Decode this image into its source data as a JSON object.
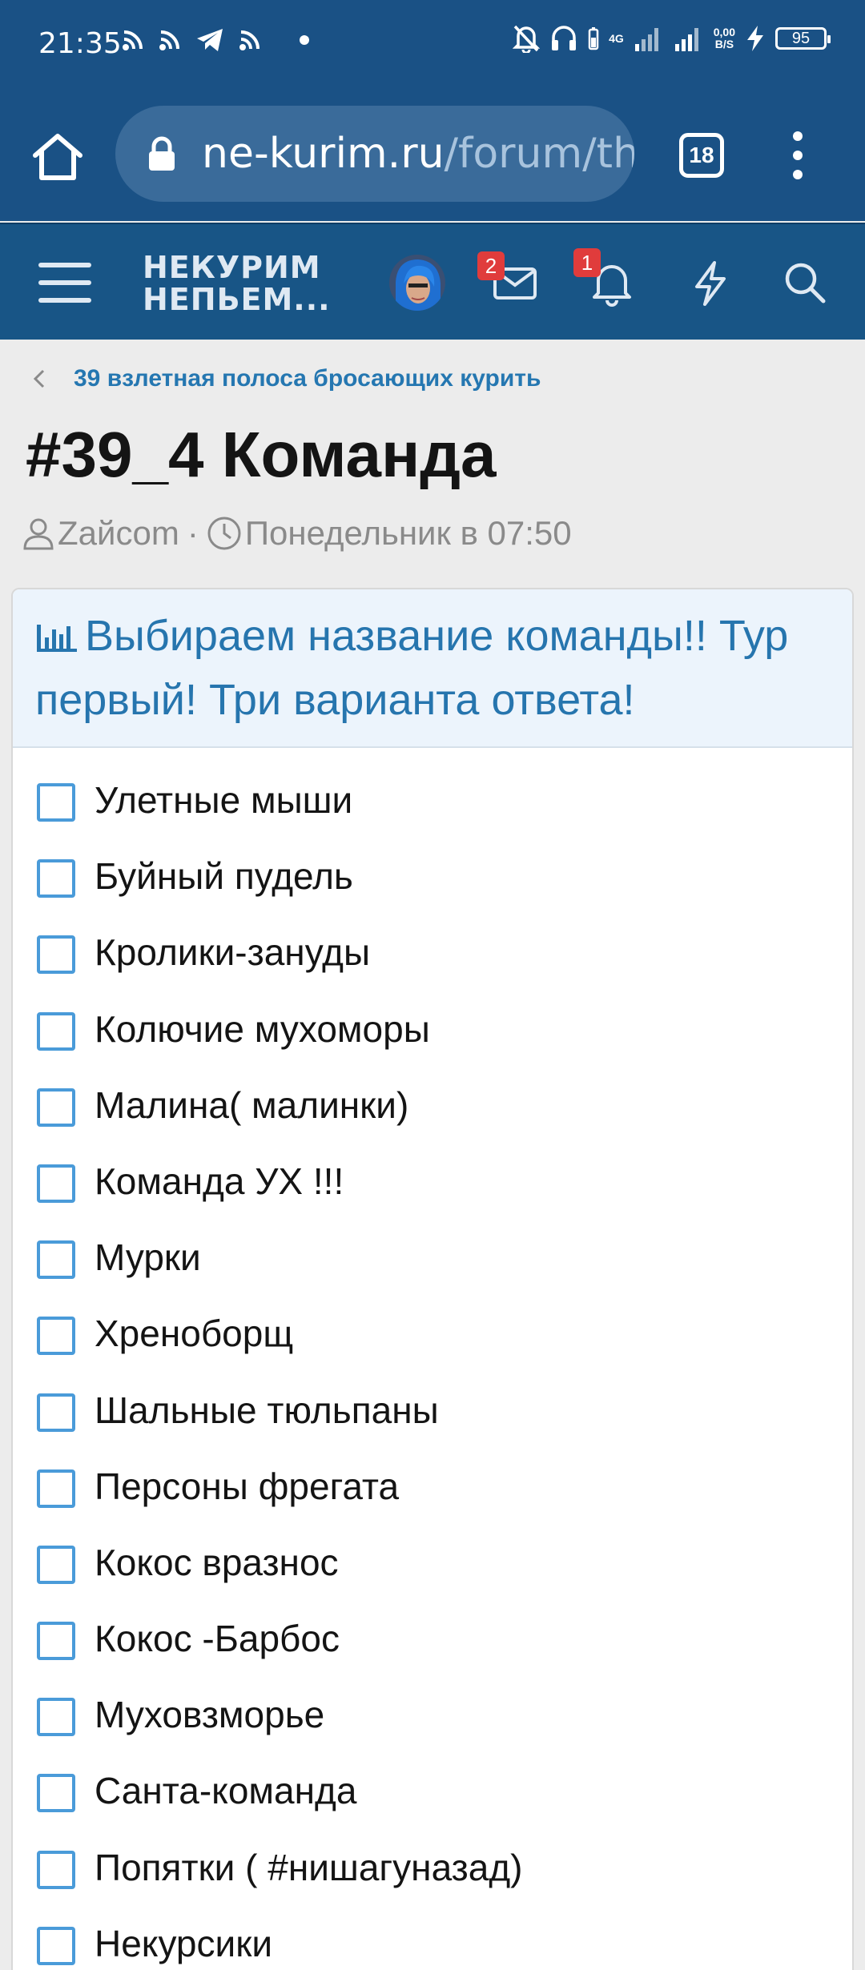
{
  "status_bar": {
    "time": "21:35",
    "network": "4G",
    "speed_value": "0,00",
    "speed_unit": "B/S",
    "battery": "95"
  },
  "browser": {
    "url_host": "ne-kurim.ru",
    "url_path": "/forum/th",
    "tab_count": "18"
  },
  "site_header": {
    "logo_line1": "НЕКУРИМ",
    "logo_line2": "НЕПЬЕМ...",
    "messages_badge": "2",
    "alerts_badge": "1"
  },
  "breadcrumb": {
    "label": "39 взлетная полоса бросающих курить"
  },
  "thread": {
    "title": "#39_4 Команда",
    "author": "Zайcom",
    "separator": "·",
    "date": "Понедельник в 07:50"
  },
  "poll": {
    "question": "Выбираем название команды!! Тур первый! Три варианта ответа!",
    "options": [
      "Улетные мыши",
      "Буйный пудель",
      "Кролики-зануды",
      "Колючие мухоморы",
      "Малина( малинки)",
      "Команда УХ !!!",
      "Мурки",
      "Хреноборщ",
      "Шальные тюльпаны",
      "Персоны фрегата",
      "Кокос вразнос",
      "Кокос -Барбос",
      "Муховзморье",
      "Санта-команда",
      "Попятки ( #нишагуназад)",
      "Некурсики"
    ]
  },
  "colors": {
    "header_bg": "#1a5185",
    "accent": "#2675ae",
    "checkbox": "#4a9bd9",
    "badge": "#e03c3c"
  }
}
